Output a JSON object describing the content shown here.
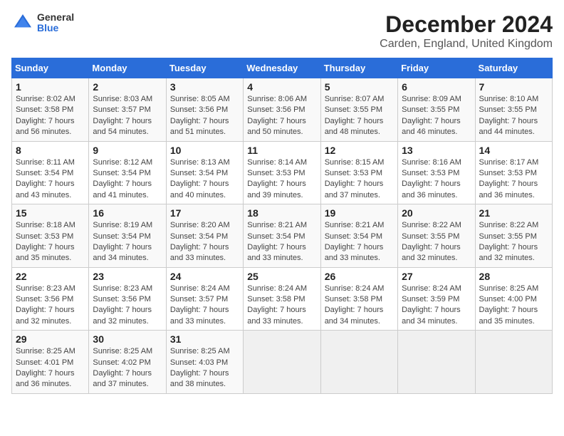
{
  "header": {
    "logo": {
      "general": "General",
      "blue": "Blue"
    },
    "title": "December 2024",
    "subtitle": "Carden, England, United Kingdom"
  },
  "columns": [
    "Sunday",
    "Monday",
    "Tuesday",
    "Wednesday",
    "Thursday",
    "Friday",
    "Saturday"
  ],
  "weeks": [
    [
      {
        "day": "1",
        "sunrise": "Sunrise: 8:02 AM",
        "sunset": "Sunset: 3:58 PM",
        "daylight": "Daylight: 7 hours and 56 minutes."
      },
      {
        "day": "2",
        "sunrise": "Sunrise: 8:03 AM",
        "sunset": "Sunset: 3:57 PM",
        "daylight": "Daylight: 7 hours and 54 minutes."
      },
      {
        "day": "3",
        "sunrise": "Sunrise: 8:05 AM",
        "sunset": "Sunset: 3:56 PM",
        "daylight": "Daylight: 7 hours and 51 minutes."
      },
      {
        "day": "4",
        "sunrise": "Sunrise: 8:06 AM",
        "sunset": "Sunset: 3:56 PM",
        "daylight": "Daylight: 7 hours and 50 minutes."
      },
      {
        "day": "5",
        "sunrise": "Sunrise: 8:07 AM",
        "sunset": "Sunset: 3:55 PM",
        "daylight": "Daylight: 7 hours and 48 minutes."
      },
      {
        "day": "6",
        "sunrise": "Sunrise: 8:09 AM",
        "sunset": "Sunset: 3:55 PM",
        "daylight": "Daylight: 7 hours and 46 minutes."
      },
      {
        "day": "7",
        "sunrise": "Sunrise: 8:10 AM",
        "sunset": "Sunset: 3:55 PM",
        "daylight": "Daylight: 7 hours and 44 minutes."
      }
    ],
    [
      {
        "day": "8",
        "sunrise": "Sunrise: 8:11 AM",
        "sunset": "Sunset: 3:54 PM",
        "daylight": "Daylight: 7 hours and 43 minutes."
      },
      {
        "day": "9",
        "sunrise": "Sunrise: 8:12 AM",
        "sunset": "Sunset: 3:54 PM",
        "daylight": "Daylight: 7 hours and 41 minutes."
      },
      {
        "day": "10",
        "sunrise": "Sunrise: 8:13 AM",
        "sunset": "Sunset: 3:54 PM",
        "daylight": "Daylight: 7 hours and 40 minutes."
      },
      {
        "day": "11",
        "sunrise": "Sunrise: 8:14 AM",
        "sunset": "Sunset: 3:53 PM",
        "daylight": "Daylight: 7 hours and 39 minutes."
      },
      {
        "day": "12",
        "sunrise": "Sunrise: 8:15 AM",
        "sunset": "Sunset: 3:53 PM",
        "daylight": "Daylight: 7 hours and 37 minutes."
      },
      {
        "day": "13",
        "sunrise": "Sunrise: 8:16 AM",
        "sunset": "Sunset: 3:53 PM",
        "daylight": "Daylight: 7 hours and 36 minutes."
      },
      {
        "day": "14",
        "sunrise": "Sunrise: 8:17 AM",
        "sunset": "Sunset: 3:53 PM",
        "daylight": "Daylight: 7 hours and 36 minutes."
      }
    ],
    [
      {
        "day": "15",
        "sunrise": "Sunrise: 8:18 AM",
        "sunset": "Sunset: 3:53 PM",
        "daylight": "Daylight: 7 hours and 35 minutes."
      },
      {
        "day": "16",
        "sunrise": "Sunrise: 8:19 AM",
        "sunset": "Sunset: 3:54 PM",
        "daylight": "Daylight: 7 hours and 34 minutes."
      },
      {
        "day": "17",
        "sunrise": "Sunrise: 8:20 AM",
        "sunset": "Sunset: 3:54 PM",
        "daylight": "Daylight: 7 hours and 33 minutes."
      },
      {
        "day": "18",
        "sunrise": "Sunrise: 8:21 AM",
        "sunset": "Sunset: 3:54 PM",
        "daylight": "Daylight: 7 hours and 33 minutes."
      },
      {
        "day": "19",
        "sunrise": "Sunrise: 8:21 AM",
        "sunset": "Sunset: 3:54 PM",
        "daylight": "Daylight: 7 hours and 33 minutes."
      },
      {
        "day": "20",
        "sunrise": "Sunrise: 8:22 AM",
        "sunset": "Sunset: 3:55 PM",
        "daylight": "Daylight: 7 hours and 32 minutes."
      },
      {
        "day": "21",
        "sunrise": "Sunrise: 8:22 AM",
        "sunset": "Sunset: 3:55 PM",
        "daylight": "Daylight: 7 hours and 32 minutes."
      }
    ],
    [
      {
        "day": "22",
        "sunrise": "Sunrise: 8:23 AM",
        "sunset": "Sunset: 3:56 PM",
        "daylight": "Daylight: 7 hours and 32 minutes."
      },
      {
        "day": "23",
        "sunrise": "Sunrise: 8:23 AM",
        "sunset": "Sunset: 3:56 PM",
        "daylight": "Daylight: 7 hours and 32 minutes."
      },
      {
        "day": "24",
        "sunrise": "Sunrise: 8:24 AM",
        "sunset": "Sunset: 3:57 PM",
        "daylight": "Daylight: 7 hours and 33 minutes."
      },
      {
        "day": "25",
        "sunrise": "Sunrise: 8:24 AM",
        "sunset": "Sunset: 3:58 PM",
        "daylight": "Daylight: 7 hours and 33 minutes."
      },
      {
        "day": "26",
        "sunrise": "Sunrise: 8:24 AM",
        "sunset": "Sunset: 3:58 PM",
        "daylight": "Daylight: 7 hours and 34 minutes."
      },
      {
        "day": "27",
        "sunrise": "Sunrise: 8:24 AM",
        "sunset": "Sunset: 3:59 PM",
        "daylight": "Daylight: 7 hours and 34 minutes."
      },
      {
        "day": "28",
        "sunrise": "Sunrise: 8:25 AM",
        "sunset": "Sunset: 4:00 PM",
        "daylight": "Daylight: 7 hours and 35 minutes."
      }
    ],
    [
      {
        "day": "29",
        "sunrise": "Sunrise: 8:25 AM",
        "sunset": "Sunset: 4:01 PM",
        "daylight": "Daylight: 7 hours and 36 minutes."
      },
      {
        "day": "30",
        "sunrise": "Sunrise: 8:25 AM",
        "sunset": "Sunset: 4:02 PM",
        "daylight": "Daylight: 7 hours and 37 minutes."
      },
      {
        "day": "31",
        "sunrise": "Sunrise: 8:25 AM",
        "sunset": "Sunset: 4:03 PM",
        "daylight": "Daylight: 7 hours and 38 minutes."
      },
      null,
      null,
      null,
      null
    ]
  ]
}
